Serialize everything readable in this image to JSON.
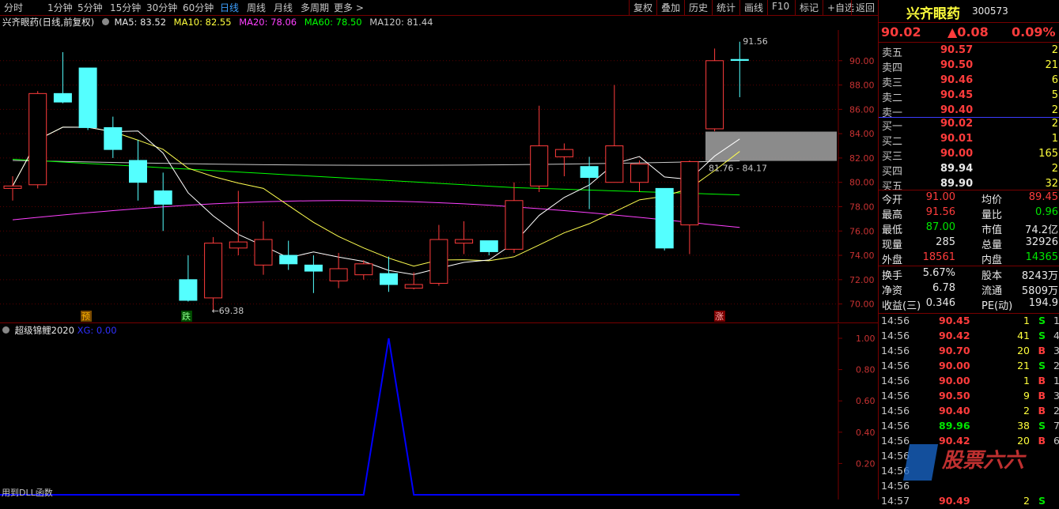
{
  "toolbar": {
    "periods": [
      "分时",
      "1分钟",
      "5分钟",
      "15分钟",
      "30分钟",
      "60分钟",
      "日线",
      "周线",
      "月线",
      "多周期",
      "更多 >"
    ],
    "active": "日线",
    "right_buttons": [
      "复权",
      "叠加",
      "历史",
      "统计",
      "画线",
      "F10",
      "标记",
      "+自选",
      "返回"
    ]
  },
  "legend": {
    "title": "兴齐眼药(日线,前复权)",
    "ma5": "MA5: 83.52",
    "ma10": "MA10: 82.55",
    "ma20": "MA20: 78.06",
    "ma60": "MA60: 78.50",
    "ma120": "MA120: 81.44"
  },
  "colors": {
    "up": "#ff3c3c",
    "down": "#54ffff",
    "ma5": "#ffffff",
    "ma10": "#ffff50",
    "ma20": "#ff40ff",
    "ma60": "#00ff00",
    "ma120": "#c8c8c8",
    "indicator": "#0000ff"
  },
  "chart_data": [
    {
      "type": "candlestick",
      "y_ticks": [
        "90.00",
        "88.00",
        "86.00",
        "84.00",
        "82.00",
        "80.00",
        "78.00",
        "76.00",
        "74.00",
        "72.00",
        "70.00"
      ],
      "ylim": [
        69.0,
        92.0
      ],
      "candles": [
        {
          "o": 79.5,
          "h": 80.5,
          "l": 78.5,
          "c": 79.7
        },
        {
          "o": 79.8,
          "h": 87.5,
          "l": 79.5,
          "c": 87.3
        },
        {
          "o": 87.3,
          "h": 90.7,
          "l": 86.5,
          "c": 86.6
        },
        {
          "o": 89.4,
          "h": 89.4,
          "l": 84.3,
          "c": 84.5
        },
        {
          "o": 84.5,
          "h": 85.4,
          "l": 82.0,
          "c": 82.7
        },
        {
          "o": 81.8,
          "h": 83.5,
          "l": 78.5,
          "c": 80.0
        },
        {
          "o": 79.3,
          "h": 80.8,
          "l": 76.0,
          "c": 78.2
        },
        {
          "o": 72.0,
          "h": 74.0,
          "l": 70.2,
          "c": 70.3
        },
        {
          "o": 70.5,
          "h": 75.5,
          "l": 69.4,
          "c": 75.0
        },
        {
          "o": 74.6,
          "h": 79.3,
          "l": 74.0,
          "c": 75.1
        },
        {
          "o": 73.2,
          "h": 76.8,
          "l": 72.4,
          "c": 75.3
        },
        {
          "o": 74.0,
          "h": 75.2,
          "l": 72.8,
          "c": 73.3
        },
        {
          "o": 73.2,
          "h": 74.0,
          "l": 70.9,
          "c": 72.7
        },
        {
          "o": 71.9,
          "h": 74.2,
          "l": 71.3,
          "c": 72.9
        },
        {
          "o": 72.4,
          "h": 73.6,
          "l": 72.0,
          "c": 73.3
        },
        {
          "o": 72.5,
          "h": 73.9,
          "l": 71.0,
          "c": 71.6
        },
        {
          "o": 71.3,
          "h": 72.6,
          "l": 71.2,
          "c": 71.6
        },
        {
          "o": 71.7,
          "h": 76.5,
          "l": 71.5,
          "c": 75.3
        },
        {
          "o": 75.0,
          "h": 76.8,
          "l": 74.1,
          "c": 75.3
        },
        {
          "o": 75.2,
          "h": 75.2,
          "l": 74.0,
          "c": 74.3
        },
        {
          "o": 74.5,
          "h": 80.0,
          "l": 74.2,
          "c": 78.5
        },
        {
          "o": 79.7,
          "h": 86.3,
          "l": 79.2,
          "c": 83.0
        },
        {
          "o": 82.1,
          "h": 83.2,
          "l": 80.5,
          "c": 82.7
        },
        {
          "o": 81.3,
          "h": 82.1,
          "l": 77.8,
          "c": 80.4
        },
        {
          "o": 80.0,
          "h": 88.0,
          "l": 80.0,
          "c": 83.0
        },
        {
          "o": 80.0,
          "h": 81.8,
          "l": 79.2,
          "c": 81.5
        },
        {
          "o": 79.5,
          "h": 79.5,
          "l": 74.4,
          "c": 74.6
        },
        {
          "o": 76.5,
          "h": 81.8,
          "l": 74.1,
          "c": 81.7
        },
        {
          "o": 84.4,
          "h": 91.0,
          "l": 84.2,
          "c": 90.0
        },
        {
          "o": 90.1,
          "h": 91.56,
          "l": 87.0,
          "c": 90.02
        }
      ],
      "annotations": {
        "high": "91.56",
        "low": "←69.38",
        "range": "81.76 - 84.17",
        "tag_yu": "预",
        "tag_die": "跌",
        "tag_zhang": "涨"
      }
    },
    {
      "type": "line",
      "name": "超级锦鲤2020",
      "series_label": "XG: 0.00",
      "y_ticks": [
        "1.00",
        "0.80",
        "0.60",
        "0.40",
        "0.20"
      ],
      "ylim": [
        0,
        1.0
      ],
      "values": [
        0,
        0,
        0,
        0,
        0,
        0,
        0,
        0,
        0,
        0,
        0,
        0,
        0,
        0,
        0,
        1,
        0,
        0,
        0,
        0,
        0,
        0,
        0,
        0,
        0,
        0,
        0,
        0,
        0,
        0
      ],
      "footer": "用到DLL函数"
    }
  ],
  "quote": {
    "name": "兴齐眼药",
    "code": "300573",
    "price": "90.02",
    "change": "▲0.08",
    "pct": "0.09%",
    "asks": [
      {
        "label": "卖五",
        "price": "90.57",
        "vol": "2"
      },
      {
        "label": "卖四",
        "price": "90.50",
        "vol": "21"
      },
      {
        "label": "卖三",
        "price": "90.46",
        "vol": "6"
      },
      {
        "label": "卖二",
        "price": "90.45",
        "vol": "5"
      },
      {
        "label": "卖一",
        "price": "90.40",
        "vol": "2"
      }
    ],
    "bids": [
      {
        "label": "买一",
        "price": "90.02",
        "vol": "2"
      },
      {
        "label": "买二",
        "price": "90.01",
        "vol": "1"
      },
      {
        "label": "买三",
        "price": "90.00",
        "vol": "165"
      },
      {
        "label": "买四",
        "price": "89.94",
        "vol": "2"
      },
      {
        "label": "买五",
        "price": "89.90",
        "vol": "32"
      }
    ],
    "stats": [
      {
        "l1": "今开",
        "v1": "91.00",
        "l2": "均价",
        "v2": "89.45"
      },
      {
        "l1": "最高",
        "v1": "91.56",
        "l2": "量比",
        "v2": "0.96"
      },
      {
        "l1": "最低",
        "v1": "87.00",
        "l2": "市值",
        "v2": "74.2亿"
      },
      {
        "l1": "现量",
        "v1": "285",
        "l2": "总量",
        "v2": "32926"
      },
      {
        "l1": "外盘",
        "v1": "18561",
        "l2": "内盘",
        "v2": "14365"
      }
    ],
    "stats2": [
      {
        "l1": "换手",
        "v1": "5.67%",
        "l2": "股本",
        "v2": "8243万"
      },
      {
        "l1": "净资",
        "v1": "6.78",
        "l2": "流通",
        "v2": "5809万"
      },
      {
        "l1": "收益(三)",
        "v1": "0.346",
        "l2": "PE(动)",
        "v2": "194.9"
      }
    ],
    "ticks": [
      {
        "t": "14:56",
        "p": "90.45",
        "q": "1",
        "d": "S",
        "n": "1"
      },
      {
        "t": "14:56",
        "p": "90.42",
        "q": "41",
        "d": "S",
        "n": "4"
      },
      {
        "t": "14:56",
        "p": "90.70",
        "q": "20",
        "d": "B",
        "n": "3"
      },
      {
        "t": "14:56",
        "p": "90.00",
        "q": "21",
        "d": "S",
        "n": "2"
      },
      {
        "t": "14:56",
        "p": "90.00",
        "q": "1",
        "d": "B",
        "n": "1"
      },
      {
        "t": "14:56",
        "p": "90.50",
        "q": "9",
        "d": "B",
        "n": "3"
      },
      {
        "t": "14:56",
        "p": "90.40",
        "q": "2",
        "d": "B",
        "n": "2"
      },
      {
        "t": "14:56",
        "p": "89.96",
        "q": "38",
        "d": "S",
        "n": "7"
      },
      {
        "t": "14:56",
        "p": "90.42",
        "q": "20",
        "d": "B",
        "n": "6"
      },
      {
        "t": "14:56",
        "p": "",
        "q": "",
        "d": "",
        "n": ""
      },
      {
        "t": "14:56",
        "p": "",
        "q": "",
        "d": "",
        "n": ""
      },
      {
        "t": "14:56",
        "p": "",
        "q": "",
        "d": "",
        "n": ""
      },
      {
        "t": "14:57",
        "p": "90.49",
        "q": "2",
        "d": "S",
        "n": ""
      }
    ],
    "watermark": "股票六六"
  }
}
